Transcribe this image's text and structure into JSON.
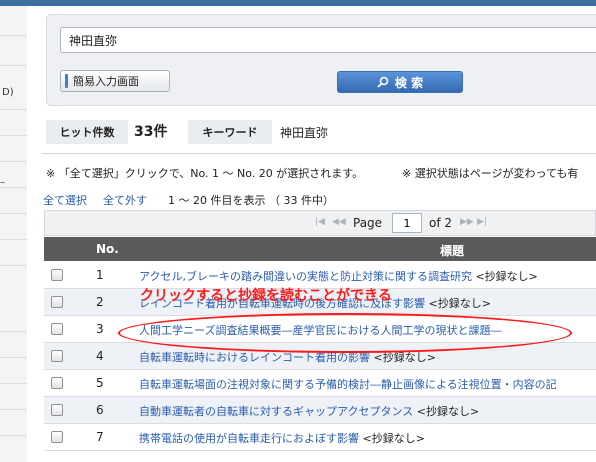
{
  "search": {
    "query": "神田直弥",
    "simple_input_label": "簡易入力画面",
    "search_label": "検 索"
  },
  "hits": {
    "count_label": "ヒット件数",
    "count": "33件",
    "keyword_label": "キーワード",
    "keyword": "神田直弥"
  },
  "notes": {
    "select_note": "※ 「全て選択」クリックで、No. 1 〜 No. 20 が選択されます。",
    "state_note": "※ 選択状態はページが変わっても有"
  },
  "controls": {
    "select_all": "全て選択",
    "unselect_all": "全て外す",
    "range": "1 〜 20 件目を表示 （ 33 件中）"
  },
  "pager": {
    "page_label": "Page",
    "current_page": "1",
    "of_label": "of 2"
  },
  "table": {
    "col_no": "No.",
    "col_title": "標題",
    "rows": [
      {
        "no": "1",
        "title": "アクセル,ブレーキの踏み間違いの実態と防止対策に関する調査研究",
        "note": " <抄録なし>"
      },
      {
        "no": "2",
        "title": "レインコート着用が自転車運転時の後方確認に及ぼす影響",
        "note": " <抄録なし>"
      },
      {
        "no": "3",
        "title": "人間工学ニーズ調査結果概要―産学官民における人間工学の現状と課題―",
        "note": ""
      },
      {
        "no": "4",
        "title": "自転車運転時におけるレインコート着用の影響",
        "note": " <抄録なし>"
      },
      {
        "no": "5",
        "title": "自転車運転場面の注視対象に関する予備的検討―静止画像による注視位置・内容の記",
        "note": ""
      },
      {
        "no": "6",
        "title": "自動車運転者の自転車に対するギャップアクセプタンス",
        "note": " <抄録なし>"
      },
      {
        "no": "7",
        "title": "携帯電話の使用が自転車走行におよぼす影響",
        "note": " <抄録なし>"
      }
    ]
  },
  "annotation": {
    "text": "クリックすると抄録を読むことができる"
  },
  "sidebar": {
    "partial_text_1": "D)",
    "partial_text_2": "–"
  },
  "colors": {
    "accent": "#3e6e9b",
    "link": "#2a5db0",
    "annotation": "#ff1a1a",
    "table_header": "#5a5a5a"
  }
}
